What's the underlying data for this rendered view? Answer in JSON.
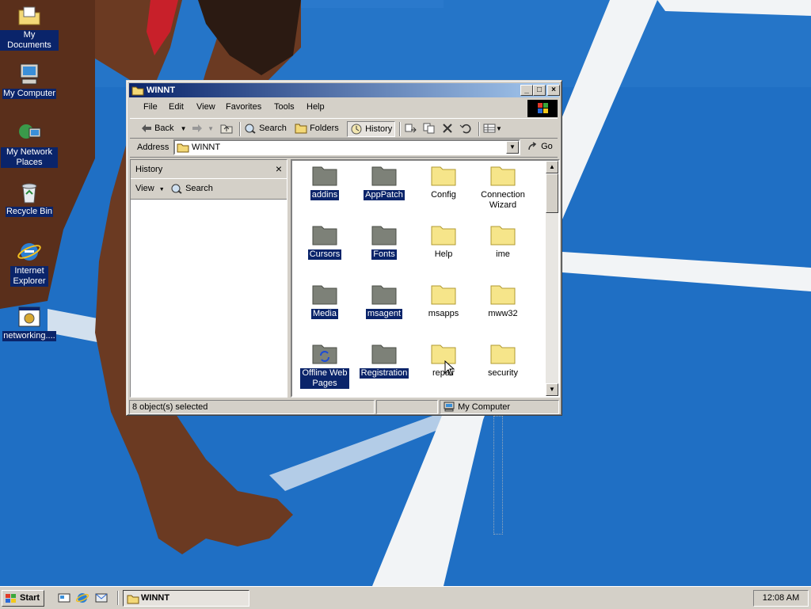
{
  "desktop": {
    "icons": [
      {
        "label": "My Documents"
      },
      {
        "label": "My Computer"
      },
      {
        "label": "My Network Places"
      },
      {
        "label": "Recycle Bin"
      },
      {
        "label": "Internet Explorer"
      },
      {
        "label": "networking...."
      }
    ]
  },
  "window": {
    "title": "WINNT",
    "menu": [
      "File",
      "Edit",
      "View",
      "Favorites",
      "Tools",
      "Help"
    ],
    "toolbar": {
      "back": "Back",
      "search": "Search",
      "folders": "Folders",
      "history": "History"
    },
    "address": {
      "label": "Address",
      "value": "WINNT",
      "go": "Go"
    },
    "history_pane": {
      "title": "History",
      "view": "View",
      "search": "Search"
    },
    "files": [
      {
        "name": "addins",
        "selected": true,
        "color": "#7d8178"
      },
      {
        "name": "AppPatch",
        "selected": true,
        "color": "#7d8178"
      },
      {
        "name": "Config",
        "selected": false,
        "color": "#f6e58a"
      },
      {
        "name": "Connection Wizard",
        "selected": false,
        "color": "#f6e58a"
      },
      {
        "name": "Cursors",
        "selected": true,
        "color": "#7d8178"
      },
      {
        "name": "Fonts",
        "selected": true,
        "color": "#7d8178"
      },
      {
        "name": "Help",
        "selected": false,
        "color": "#f6e58a"
      },
      {
        "name": "ime",
        "selected": false,
        "color": "#f6e58a"
      },
      {
        "name": "Media",
        "selected": true,
        "color": "#7d8178"
      },
      {
        "name": "msagent",
        "selected": true,
        "color": "#7d8178"
      },
      {
        "name": "msapps",
        "selected": false,
        "color": "#f6e58a"
      },
      {
        "name": "mww32",
        "selected": false,
        "color": "#f6e58a"
      },
      {
        "name": "Offline Web Pages",
        "selected": true,
        "color": "#7d8178"
      },
      {
        "name": "Registration",
        "selected": true,
        "color": "#7d8178"
      },
      {
        "name": "repair",
        "selected": false,
        "color": "#f6e58a"
      },
      {
        "name": "security",
        "selected": false,
        "color": "#f6e58a"
      }
    ],
    "status": {
      "selection": "8 object(s) selected",
      "zone": "My Computer"
    }
  },
  "taskbar": {
    "start": "Start",
    "task": "WINNT",
    "clock": "12:08 AM"
  },
  "colors": {
    "selection": "#0a246a",
    "track_blue": "#1f6fc4",
    "face": "#d4d0c8"
  }
}
